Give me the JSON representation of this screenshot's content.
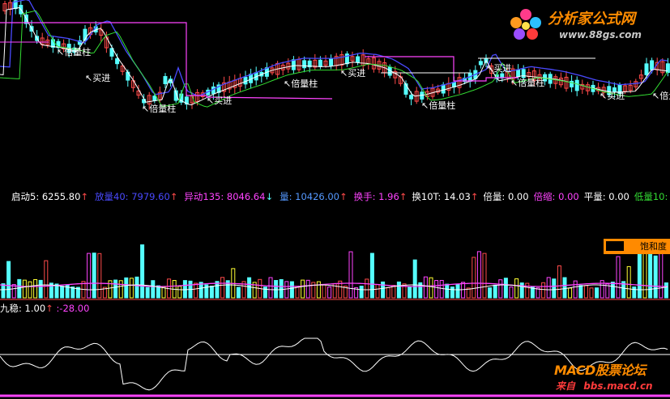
{
  "colors": {
    "up": "#ff4a4a",
    "down": "#55ffff",
    "yellow": "#ffff33",
    "magenta": "#ff44ff",
    "blue": "#4a4aff",
    "white": "#ffffff",
    "orange": "#ff8a00",
    "green": "#33dd33",
    "label": "#ffffff"
  },
  "chart_labels": {
    "buy": "买进",
    "bei_liang": "倍量柱"
  },
  "indicators": [
    {
      "label": "启动5: 6255.80",
      "arrow": "↑",
      "color": "#ffffff",
      "arrow_color": "#ff4a4a"
    },
    {
      "label": "放量40: 7979.60",
      "arrow": "↑",
      "color": "#4a4aff",
      "arrow_color": "#ff4a4a"
    },
    {
      "label": "异动135: 8046.64",
      "arrow": "↓",
      "color": "#ff44ff",
      "arrow_color": "#55ffff"
    },
    {
      "label": "量: 10426.00",
      "arrow": "↑",
      "color": "#5599ff",
      "arrow_color": "#ff4a4a"
    },
    {
      "label": "换手: 1.96",
      "arrow": "↑",
      "color": "#ff44ff",
      "arrow_color": "#ff4a4a"
    },
    {
      "label": "换10T: 14.03",
      "arrow": "↑",
      "color": "#ffffff",
      "arrow_color": "#ff4a4a"
    },
    {
      "label": "倍量: 0.00",
      "arrow": "",
      "color": "#ffffff",
      "arrow_color": "#ffffff"
    },
    {
      "label": "倍缩: 0.00",
      "arrow": "",
      "color": "#ff44ff",
      "arrow_color": "#ffffff"
    },
    {
      "label": "平量: 0.00",
      "arrow": "",
      "color": "#ffffff",
      "arrow_color": "#ffffff"
    },
    {
      "label": "低量10: 0.00",
      "arrow": "",
      "color": "#33dd33",
      "arrow_color": "#ffffff"
    },
    {
      "label": "",
      "arrow": "",
      "color": "#ffffff",
      "arrow_color": "#ffffff"
    }
  ],
  "sub_indicator": {
    "label": "九稳: 1.00",
    "arrow": "↑",
    "value": ":-28.00",
    "label_color": "#ffffff",
    "value_color": "#ff44ff"
  },
  "saturation_label": "饱和度",
  "logo_top": {
    "title": "分析家公式网",
    "url": "www.88gs.com"
  },
  "logo_bottom": {
    "title": "MACD股票论坛",
    "source_label": "来自",
    "url": "bbs.macd.cn"
  }
}
